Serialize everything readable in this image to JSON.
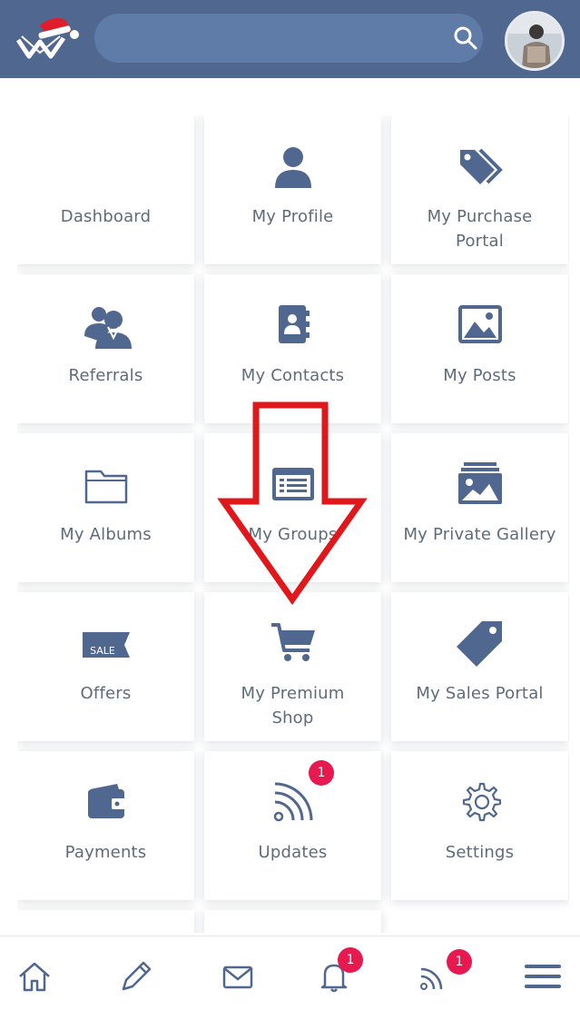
{
  "header": {
    "search": {
      "placeholder": "",
      "value": ""
    },
    "brand_color": "#50688f"
  },
  "tiles": [
    {
      "label": "Dashboard",
      "icon": "dashboard-icon"
    },
    {
      "label": "My Profile",
      "icon": "user-icon"
    },
    {
      "label": "My Purchase Portal",
      "label_lines": [
        "My Purchase",
        "Portal"
      ],
      "icon": "tags-icon"
    },
    {
      "label": "Referrals",
      "icon": "users-icon"
    },
    {
      "label": "My Contacts",
      "icon": "address-book-icon"
    },
    {
      "label": "My Posts",
      "icon": "image-icon"
    },
    {
      "label": "My Albums",
      "icon": "folder-icon"
    },
    {
      "label": "My Groups",
      "icon": "list-card-icon"
    },
    {
      "label": "My Private Gallery",
      "icon": "gallery-icon"
    },
    {
      "label": "Offers",
      "icon": "sale-tag-icon",
      "icon_text": "SALE"
    },
    {
      "label": "My Premium Shop",
      "label_lines": [
        "My Premium",
        "Shop"
      ],
      "icon": "cart-icon"
    },
    {
      "label": "My Sales Portal",
      "icon": "price-tag-icon"
    },
    {
      "label": "Payments",
      "icon": "wallet-icon"
    },
    {
      "label": "Updates",
      "icon": "rss-icon",
      "badge": "1"
    },
    {
      "label": "Settings",
      "icon": "gear-icon"
    }
  ],
  "bottom_nav": {
    "items": [
      {
        "icon": "home-icon"
      },
      {
        "icon": "pencil-icon"
      },
      {
        "icon": "mail-icon"
      },
      {
        "icon": "bell-icon",
        "badge": "1"
      },
      {
        "icon": "rss-icon",
        "badge": "1"
      },
      {
        "icon": "hamburger-menu-icon"
      }
    ]
  },
  "colors": {
    "icon": "#50688f",
    "label": "#5f6b7a",
    "badge": "#e8194f",
    "annotation_arrow": "#e0171b"
  }
}
